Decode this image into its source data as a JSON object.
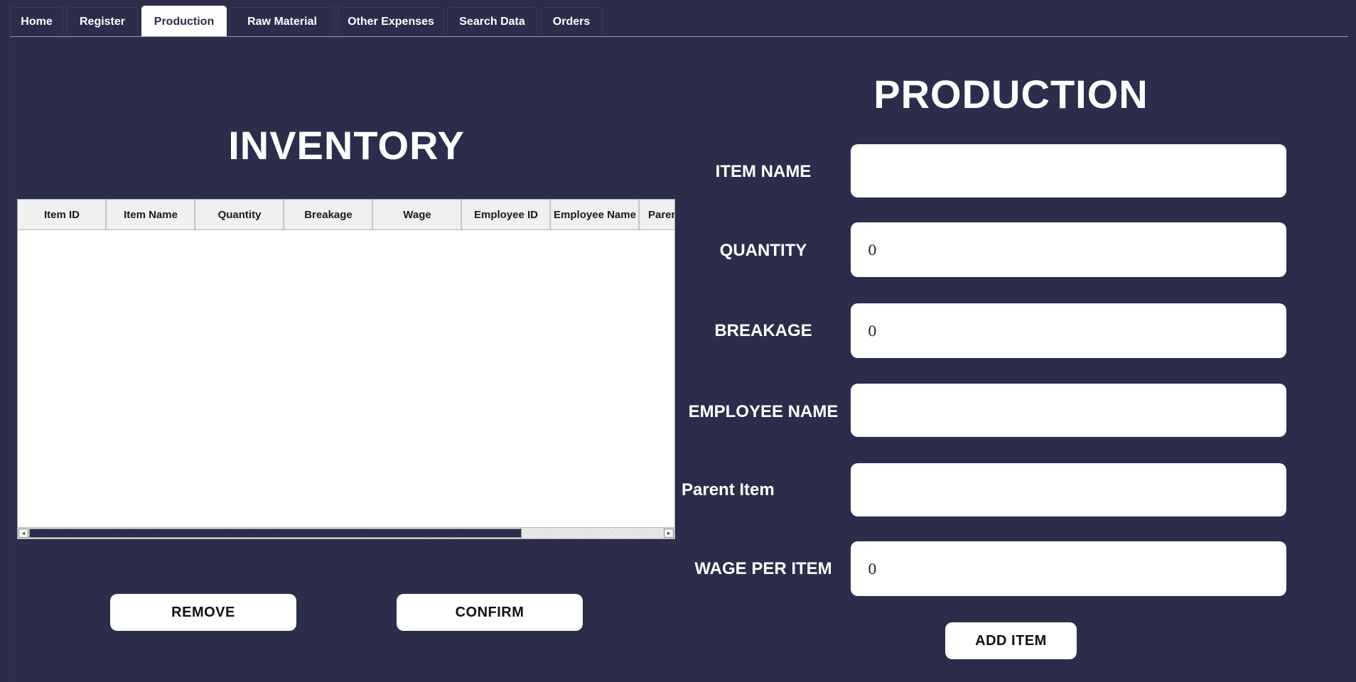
{
  "tabs": [
    {
      "label": "Home",
      "active": false
    },
    {
      "label": "Register",
      "active": false
    },
    {
      "label": "Production",
      "active": true
    },
    {
      "label": "Raw Material",
      "active": false
    },
    {
      "label": "Other Expenses",
      "active": false
    },
    {
      "label": "Search Data",
      "active": false
    },
    {
      "label": "Orders",
      "active": false
    }
  ],
  "inventory": {
    "title": "INVENTORY",
    "columns": [
      "Item ID",
      "Item Name",
      "Quantity",
      "Breakage",
      "Wage",
      "Employee ID",
      "Employee Name",
      "Paren"
    ],
    "rows": [],
    "scroll_arrow_left": "◂",
    "scroll_arrow_right": "▸"
  },
  "actions": {
    "remove_label": "REMOVE",
    "confirm_label": "CONFIRM"
  },
  "production": {
    "title": "PRODUCTION",
    "fields": [
      {
        "label": "ITEM NAME",
        "value": ""
      },
      {
        "label": "QUANTITY",
        "value": "0"
      },
      {
        "label": "BREAKAGE",
        "value": "0"
      },
      {
        "label": "EMPLOYEE NAME",
        "value": ""
      },
      {
        "label": "Parent Item",
        "value": ""
      },
      {
        "label": "WAGE PER ITEM",
        "value": "0"
      }
    ],
    "add_label": "ADD ITEM"
  },
  "colors": {
    "background": "#2b2d4a",
    "surface": "#ffffff",
    "text_on_dark": "#ffffff"
  }
}
